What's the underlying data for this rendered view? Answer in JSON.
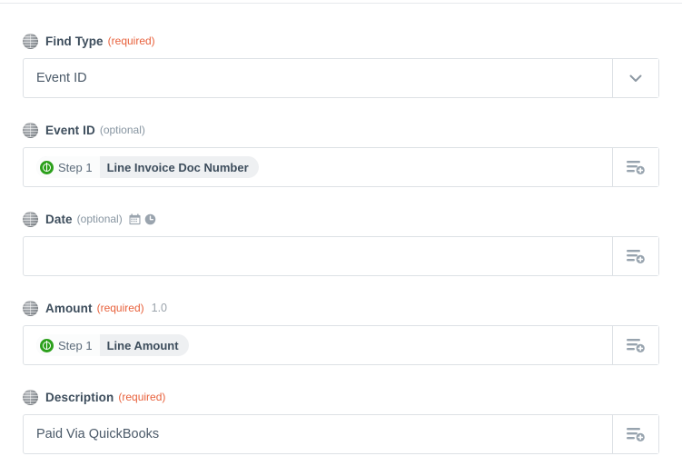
{
  "form": {
    "fields": [
      {
        "id": "find-type",
        "label": "Find Type",
        "qualifier": "(required)",
        "qualifier_kind": "required",
        "extra": "",
        "icons": [],
        "control": "select",
        "value": "Event ID",
        "side_icon": "chevron-down-icon"
      },
      {
        "id": "event-id",
        "label": "Event ID",
        "qualifier": "(optional)",
        "qualifier_kind": "optional",
        "extra": "",
        "icons": [],
        "control": "token",
        "token_app_icon": "quickbooks-icon",
        "token_step": "Step 1",
        "token_field": "Line Invoice Doc Number",
        "side_icon": "insert-data-icon"
      },
      {
        "id": "date",
        "label": "Date",
        "qualifier": "(optional)",
        "qualifier_kind": "optional",
        "extra": "",
        "icons": [
          "calendar-icon",
          "clock-icon"
        ],
        "control": "text",
        "value": "",
        "side_icon": "insert-data-icon"
      },
      {
        "id": "amount",
        "label": "Amount",
        "qualifier": "(required)",
        "qualifier_kind": "required",
        "extra": "1.0",
        "icons": [],
        "control": "token",
        "token_app_icon": "quickbooks-icon",
        "token_step": "Step 1",
        "token_field": "Line Amount",
        "side_icon": "insert-data-icon"
      },
      {
        "id": "description",
        "label": "Description",
        "qualifier": "(required)",
        "qualifier_kind": "required",
        "extra": "",
        "icons": [],
        "control": "text",
        "value": "Paid Via QuickBooks",
        "side_icon": "insert-data-icon"
      }
    ]
  },
  "colors": {
    "required": "#e8613c",
    "optional": "#8795a1",
    "label": "#3d4d5c",
    "value": "#4a5968",
    "border": "#dde1e5",
    "quickbooks_green": "#2ca01c",
    "token_bg": "#eef0f2"
  }
}
